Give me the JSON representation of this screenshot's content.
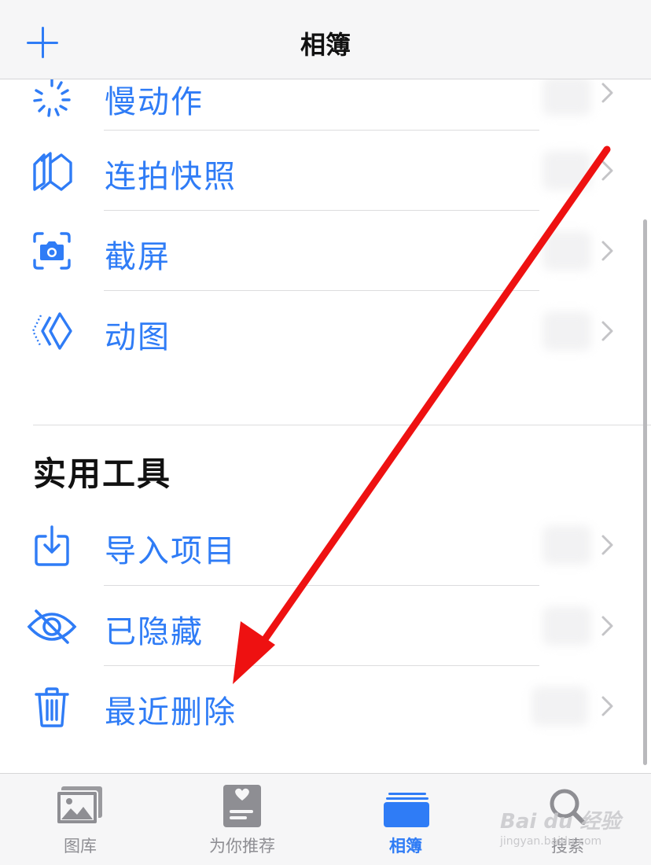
{
  "header": {
    "title": "相簿",
    "add_icon": "plus-icon"
  },
  "list": {
    "items": [
      {
        "label": "慢动作",
        "icon": "slow-motion-icon"
      },
      {
        "label": "连拍快照",
        "icon": "burst-icon"
      },
      {
        "label": "截屏",
        "icon": "screenshot-icon"
      },
      {
        "label": "动图",
        "icon": "animated-icon"
      }
    ],
    "section_title": "实用工具",
    "tools": [
      {
        "label": "导入项目",
        "icon": "import-icon"
      },
      {
        "label": "已隐藏",
        "icon": "hidden-eye-icon"
      },
      {
        "label": "最近删除",
        "icon": "trash-icon"
      }
    ]
  },
  "tabs": [
    {
      "label": "图库",
      "icon": "photos-icon",
      "active": false
    },
    {
      "label": "为你推荐",
      "icon": "for-you-icon",
      "active": false
    },
    {
      "label": "相簿",
      "icon": "albums-icon",
      "active": true
    },
    {
      "label": "搜索",
      "icon": "search-icon",
      "active": false
    }
  ],
  "watermark": {
    "text": "Bai du 经验",
    "sub": "jingyan.baidu.com"
  },
  "colors": {
    "accent": "#2f7cf6",
    "annotation_arrow": "#ee1111"
  }
}
